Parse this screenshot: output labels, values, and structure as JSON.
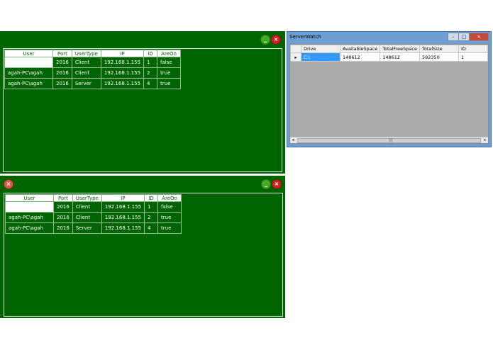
{
  "panels": [
    {
      "buttons": {
        "minimize": "_",
        "close": "×",
        "left_close": "×"
      },
      "columns": [
        "User",
        "Port",
        "UserType",
        "IP",
        "ID",
        "AreOn"
      ],
      "rows": [
        [
          "",
          "2016",
          "Client",
          "192.168.1.155",
          "1",
          "false"
        ],
        [
          "agah-PC\\agah",
          "2016",
          "Client",
          "192.168.1.155",
          "2",
          "true"
        ],
        [
          "agah-PC\\agah",
          "2016",
          "Server",
          "192.168.1.155",
          "4",
          "true"
        ]
      ]
    },
    {
      "buttons": {
        "minimize": "_",
        "close": "×",
        "left_close": "×"
      },
      "columns": [
        "User",
        "Port",
        "UserType",
        "IP",
        "ID",
        "AreOn"
      ],
      "rows": [
        [
          "",
          "2016",
          "Client",
          "192.168.1.155",
          "1",
          "false"
        ],
        [
          "agah-PC\\agah",
          "2016",
          "Client",
          "192.168.1.155",
          "2",
          "true"
        ],
        [
          "agah-PC\\agah",
          "2016",
          "Server",
          "192.168.1.155",
          "4",
          "true"
        ]
      ]
    }
  ],
  "server_watch": {
    "title": "ServerWatch",
    "controls": {
      "minimize": "–",
      "maximize": "□",
      "close": "×"
    },
    "columns": [
      "Drive",
      "AvailableSpace",
      "TotalFreeSpace",
      "TotalSize",
      "ID"
    ],
    "rows": [
      [
        "C:\\",
        "148612",
        "148612",
        "592350",
        "1"
      ]
    ],
    "row_marker": "▸",
    "scroll": {
      "left": "◂",
      "right": "▸",
      "grip": "|||"
    }
  },
  "colors": {
    "panel_green": "#006400",
    "header_white": "#ffffff",
    "selection_blue": "#3399ff"
  }
}
